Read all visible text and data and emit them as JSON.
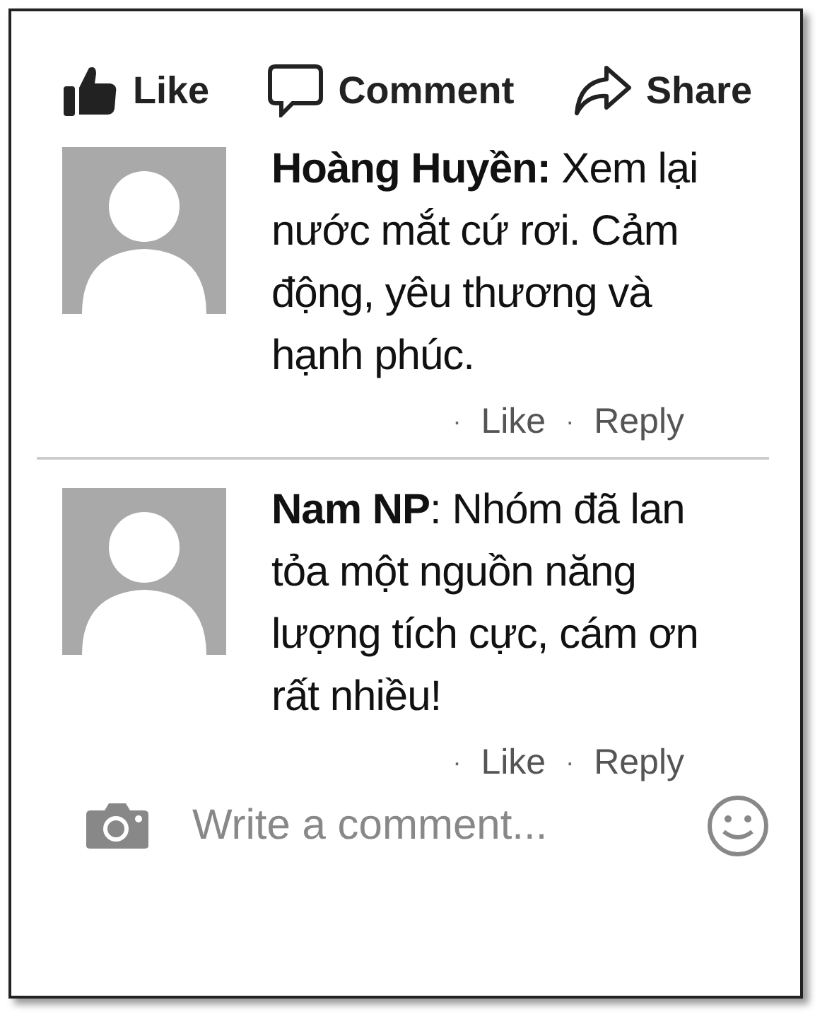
{
  "action_bar": [
    {
      "kind": "like",
      "label": "Like"
    },
    {
      "kind": "comment",
      "label": "Comment"
    },
    {
      "kind": "share",
      "label": "Share"
    }
  ],
  "comments": [
    {
      "text": "**Hoàng Huyền:** Xem lại nước mắt cứ rơi. Cảm động, yêu thương và hạnh phúc.",
      "actions": [
        {
          "dot": "·",
          "label": "Like"
        },
        {
          "dot": "·",
          "label": "Reply"
        }
      ]
    },
    {
      "text": "**Nam NP**: Nhóm đã lan tỏa một nguồn năng lượng tích cực, cám ơn rất nhiều!",
      "actions": [
        {
          "dot": "·",
          "label": "Like"
        },
        {
          "dot": "·",
          "label": "Reply"
        }
      ]
    }
  ],
  "composer": {
    "placeholder": "Write a comment..."
  }
}
